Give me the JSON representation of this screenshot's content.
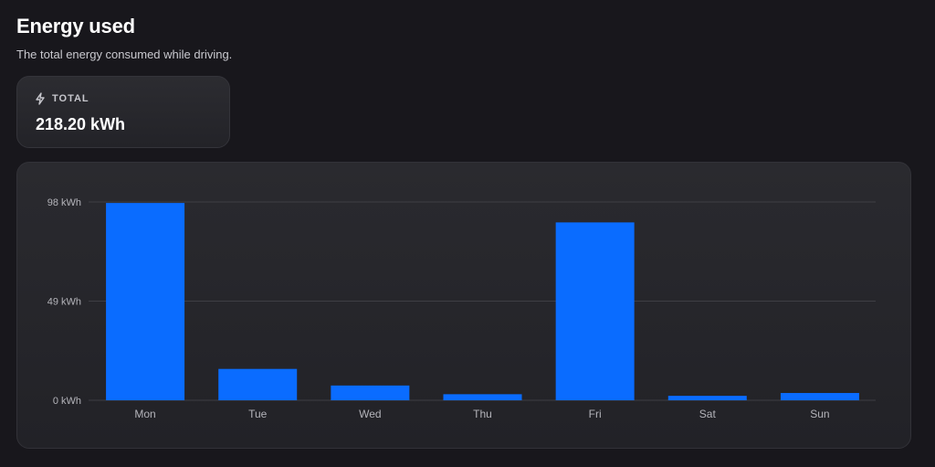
{
  "header": {
    "title": "Energy used",
    "subtitle": "The total energy consumed while driving."
  },
  "total": {
    "icon": "bolt-icon",
    "label": "TOTAL",
    "value": "218.20 kWh"
  },
  "colors": {
    "background": "#18171c",
    "bar": "#0a6cff"
  },
  "chart_data": {
    "type": "bar",
    "title": "",
    "xlabel": "",
    "ylabel": "",
    "categories": [
      "Mon",
      "Tue",
      "Wed",
      "Thu",
      "Fri",
      "Sat",
      "Sun"
    ],
    "series": [
      {
        "values": [
          97.5,
          15.5,
          7.3,
          3.0,
          87.9,
          2.2,
          3.6
        ]
      }
    ],
    "y_ticks": [
      0,
      49,
      98
    ],
    "y_tick_labels": [
      "0 kWh",
      "49 kWh",
      "98 kWh"
    ],
    "ylim": [
      0,
      98
    ],
    "grid": true,
    "legend": "none"
  }
}
